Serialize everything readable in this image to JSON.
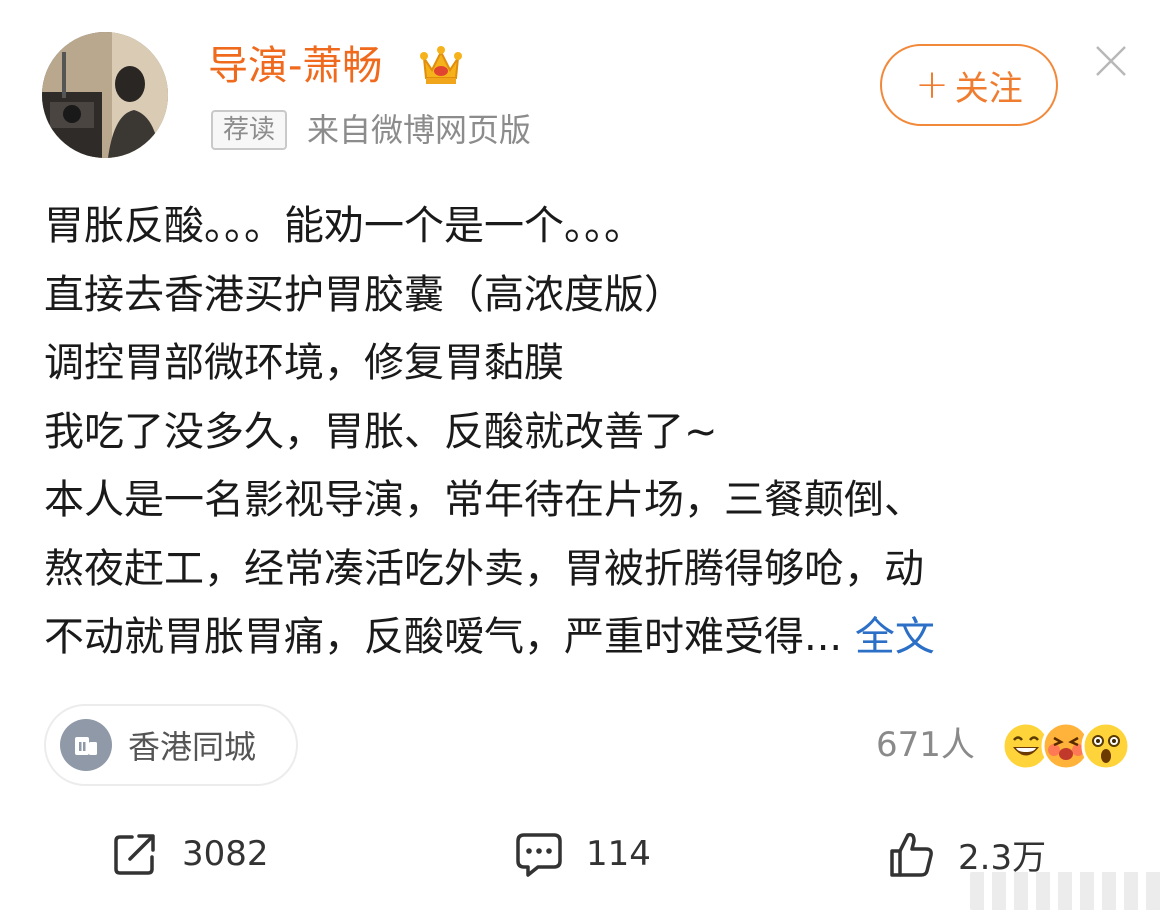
{
  "header": {
    "username": "导演-萧畅",
    "tag": "荐读",
    "source": "来自微博网页版",
    "follow_label": "关注",
    "follow_plus": "+"
  },
  "post": {
    "lines": [
      "胃胀反酸。。。能劝一个是一个。。。",
      "直接去香港买护胃胶囊（高浓度版）",
      "调控胃部微环境，修复胃黏膜",
      "我吃了没多久，胃胀、反酸就改善了~",
      "本人是一名影视导演，常年待在片场，三餐颠倒、",
      "熬夜赶工，经常凑活吃外卖，胃被折腾得够呛，动",
      "不动就胃胀胃痛，反酸嗳气，严重时难受得..."
    ],
    "full_text_link": "全文"
  },
  "location": {
    "label": "香港同城"
  },
  "reactions": {
    "count_label": "671人"
  },
  "actions": {
    "repost_count": "3082",
    "comment_count": "114",
    "like_count": "2.3万"
  },
  "colors": {
    "username": "#f06a1d",
    "follow": "#ef7c2f",
    "link": "#2c6fc7",
    "muted": "#8c8c8c"
  }
}
